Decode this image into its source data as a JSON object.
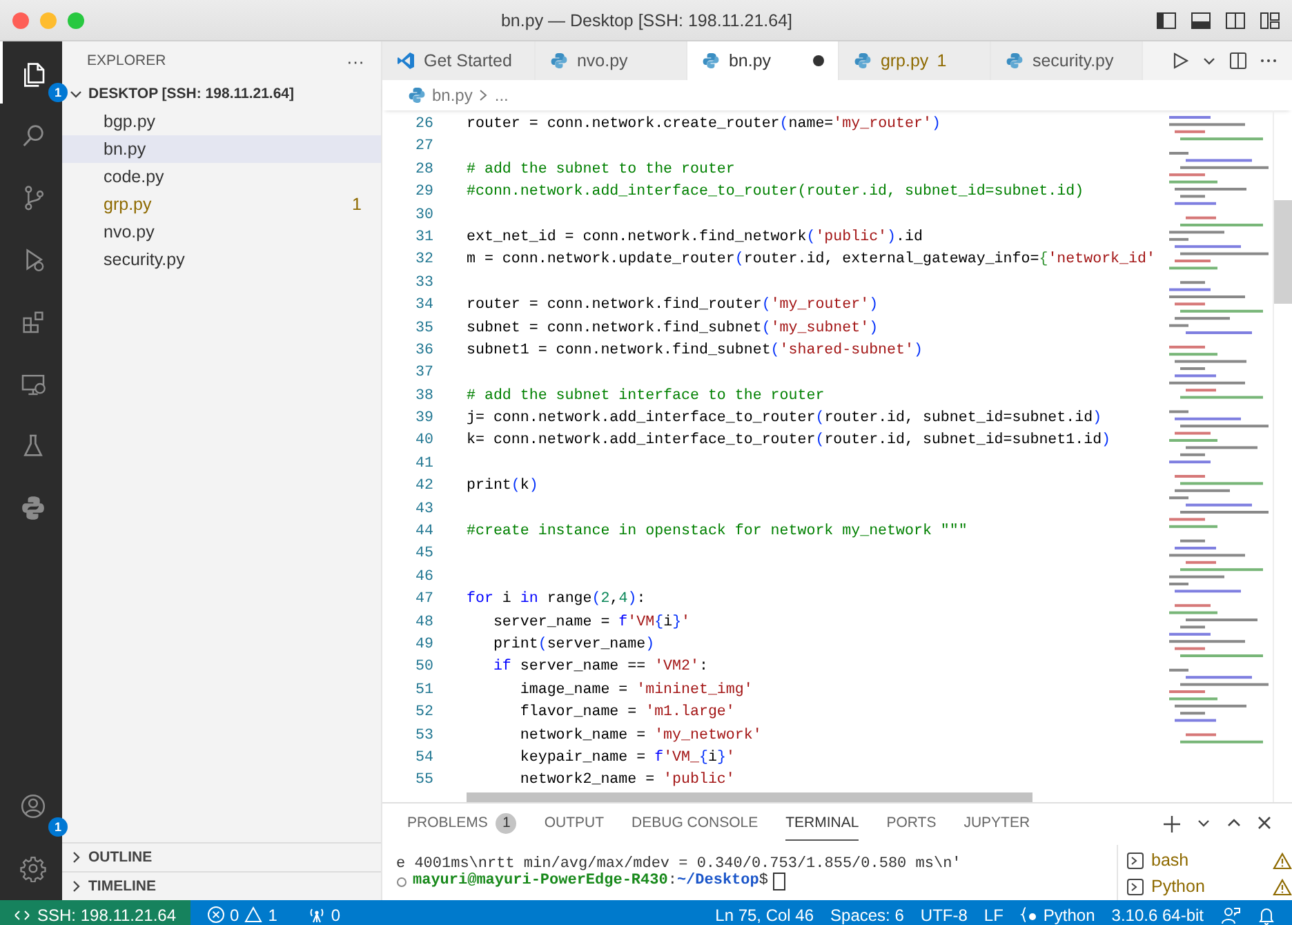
{
  "window": {
    "title": "bn.py — Desktop [SSH: 198.11.21.64]"
  },
  "activity_bar": {
    "items": [
      {
        "kind": "explorer",
        "selected": true,
        "badge": "1"
      },
      {
        "kind": "search",
        "selected": false
      },
      {
        "kind": "source-control",
        "selected": false
      },
      {
        "kind": "run",
        "selected": false
      },
      {
        "kind": "extensions",
        "selected": false
      },
      {
        "kind": "remote",
        "selected": false
      },
      {
        "kind": "testing",
        "selected": false
      },
      {
        "kind": "python",
        "selected": false
      }
    ],
    "bottom": [
      {
        "kind": "account",
        "badge": "1"
      },
      {
        "kind": "settings"
      }
    ]
  },
  "sidebar": {
    "title": "EXPLORER",
    "more": "···",
    "folder": {
      "label": "DESKTOP [SSH: 198.11.21.64]",
      "expanded": true
    },
    "files": [
      {
        "name": "bgp.py",
        "selected": false,
        "warning": false
      },
      {
        "name": "bn.py",
        "selected": true,
        "warning": false
      },
      {
        "name": "code.py",
        "selected": false,
        "warning": false
      },
      {
        "name": "grp.py",
        "selected": false,
        "warning": true,
        "problems": "1"
      },
      {
        "name": "nvo.py",
        "selected": false,
        "warning": false
      },
      {
        "name": "security.py",
        "selected": false,
        "warning": false
      }
    ],
    "sections": [
      {
        "label": "OUTLINE",
        "expanded": false
      },
      {
        "label": "TIMELINE",
        "expanded": false
      }
    ]
  },
  "tabs": [
    {
      "kind": "welcome",
      "label": "Get Started",
      "selected": false,
      "modified": false,
      "warning": false
    },
    {
      "kind": "python",
      "label": "nvo.py",
      "selected": false,
      "modified": false,
      "warning": false
    },
    {
      "kind": "python",
      "label": "bn.py",
      "selected": true,
      "modified": true,
      "warning": false
    },
    {
      "kind": "python",
      "label": "grp.py",
      "selected": false,
      "modified": false,
      "warning": true,
      "problems": "1"
    },
    {
      "kind": "python",
      "label": "security.py",
      "selected": false,
      "modified": false,
      "warning": false
    }
  ],
  "breadcrumb": [
    "bn.py",
    "..."
  ],
  "code": {
    "lines": [
      {
        "number": "26",
        "tokens": [
          {
            "kind": "plain",
            "text": "router = conn.network.create_router"
          },
          {
            "kind": "paren",
            "text": "("
          },
          {
            "kind": "plain",
            "text": "name="
          },
          {
            "kind": "string",
            "text": "'my_router'"
          },
          {
            "kind": "paren",
            "text": ")"
          }
        ]
      },
      {
        "number": "27"
      },
      {
        "number": "28",
        "tokens": [
          {
            "kind": "comment",
            "text": "# add the subnet to the router"
          }
        ]
      },
      {
        "number": "29",
        "tokens": [
          {
            "kind": "comment",
            "text": "#conn.network.add_interface_to_router(router.id, subnet_id=subnet.id)"
          }
        ]
      },
      {
        "number": "30"
      },
      {
        "number": "31",
        "tokens": [
          {
            "kind": "plain",
            "text": "ext_net_id = conn.network.find_network"
          },
          {
            "kind": "paren",
            "text": "("
          },
          {
            "kind": "string",
            "text": "'public'"
          },
          {
            "kind": "paren",
            "text": ")"
          },
          {
            "kind": "plain",
            "text": ".id"
          }
        ]
      },
      {
        "number": "32",
        "tokens": [
          {
            "kind": "plain",
            "text": "m = conn.network.update_router"
          },
          {
            "kind": "paren",
            "text": "("
          },
          {
            "kind": "plain",
            "text": "router.id, external_gateway_info="
          },
          {
            "kind": "brace",
            "text": "{"
          },
          {
            "kind": "string",
            "text": "'network_id'"
          }
        ]
      },
      {
        "number": "33"
      },
      {
        "number": "34",
        "tokens": [
          {
            "kind": "plain",
            "text": "router = conn.network.find_router"
          },
          {
            "kind": "paren",
            "text": "("
          },
          {
            "kind": "string",
            "text": "'my_router'"
          },
          {
            "kind": "paren",
            "text": ")"
          }
        ]
      },
      {
        "number": "35",
        "tokens": [
          {
            "kind": "plain",
            "text": "subnet = conn.network.find_subnet"
          },
          {
            "kind": "paren",
            "text": "("
          },
          {
            "kind": "string",
            "text": "'my_subnet'"
          },
          {
            "kind": "paren",
            "text": ")"
          }
        ]
      },
      {
        "number": "36",
        "tokens": [
          {
            "kind": "plain",
            "text": "subnet1 = conn.network.find_subnet"
          },
          {
            "kind": "paren",
            "text": "("
          },
          {
            "kind": "string",
            "text": "'shared-subnet'"
          },
          {
            "kind": "paren",
            "text": ")"
          }
        ]
      },
      {
        "number": "37"
      },
      {
        "number": "38",
        "tokens": [
          {
            "kind": "comment",
            "text": "# add the subnet interface to the router"
          }
        ]
      },
      {
        "number": "39",
        "tokens": [
          {
            "kind": "plain",
            "text": "j= conn.network.add_interface_to_router"
          },
          {
            "kind": "paren",
            "text": "("
          },
          {
            "kind": "plain",
            "text": "router.id, subnet_id=subnet.id"
          },
          {
            "kind": "paren",
            "text": ")"
          }
        ]
      },
      {
        "number": "40",
        "tokens": [
          {
            "kind": "plain",
            "text": "k= conn.network.add_interface_to_router"
          },
          {
            "kind": "paren",
            "text": "("
          },
          {
            "kind": "plain",
            "text": "router.id, subnet_id=subnet1.id"
          },
          {
            "kind": "paren",
            "text": ")"
          }
        ]
      },
      {
        "number": "41"
      },
      {
        "number": "42",
        "tokens": [
          {
            "kind": "plain",
            "text": "print"
          },
          {
            "kind": "paren",
            "text": "("
          },
          {
            "kind": "plain",
            "text": "k"
          },
          {
            "kind": "paren",
            "text": ")"
          }
        ]
      },
      {
        "number": "43"
      },
      {
        "number": "44",
        "tokens": [
          {
            "kind": "comment",
            "text": "#create instance in openstack for network my_network \"\"\""
          }
        ]
      },
      {
        "number": "45"
      },
      {
        "number": "46"
      },
      {
        "number": "47",
        "tokens": [
          {
            "kind": "keyword",
            "text": "for"
          },
          {
            "kind": "plain",
            "text": " i "
          },
          {
            "kind": "keyword",
            "text": "in"
          },
          {
            "kind": "plain",
            "text": " range"
          },
          {
            "kind": "paren",
            "text": "("
          },
          {
            "kind": "number",
            "text": "2"
          },
          {
            "kind": "plain",
            "text": ","
          },
          {
            "kind": "number",
            "text": "4"
          },
          {
            "kind": "paren",
            "text": ")"
          },
          {
            "kind": "plain",
            "text": ":"
          }
        ]
      },
      {
        "number": "48",
        "tokens": [
          {
            "kind": "plain",
            "text": "   server_name = "
          },
          {
            "kind": "keyword",
            "text": "f"
          },
          {
            "kind": "string",
            "text": "'VM"
          },
          {
            "kind": "paren",
            "text": "{"
          },
          {
            "kind": "plain",
            "text": "i"
          },
          {
            "kind": "paren",
            "text": "}"
          },
          {
            "kind": "string",
            "text": "'"
          }
        ]
      },
      {
        "number": "49",
        "tokens": [
          {
            "kind": "plain",
            "text": "   print"
          },
          {
            "kind": "paren",
            "text": "("
          },
          {
            "kind": "plain",
            "text": "server_name"
          },
          {
            "kind": "paren",
            "text": ")"
          }
        ]
      },
      {
        "number": "50",
        "tokens": [
          {
            "kind": "keyword",
            "text": "   if"
          },
          {
            "kind": "plain",
            "text": " server_name == "
          },
          {
            "kind": "string",
            "text": "'VM2'"
          },
          {
            "kind": "plain",
            "text": ":"
          }
        ]
      },
      {
        "number": "51",
        "tokens": [
          {
            "kind": "plain",
            "text": "      image_name = "
          },
          {
            "kind": "string",
            "text": "'mininet_img'"
          }
        ]
      },
      {
        "number": "52",
        "tokens": [
          {
            "kind": "plain",
            "text": "      flavor_name = "
          },
          {
            "kind": "string",
            "text": "'m1.large'"
          }
        ]
      },
      {
        "number": "53",
        "tokens": [
          {
            "kind": "plain",
            "text": "      network_name = "
          },
          {
            "kind": "string",
            "text": "'my_network'"
          }
        ]
      },
      {
        "number": "54",
        "tokens": [
          {
            "kind": "plain",
            "text": "      keypair_name = "
          },
          {
            "kind": "keyword",
            "text": "f"
          },
          {
            "kind": "string",
            "text": "'VM_"
          },
          {
            "kind": "paren",
            "text": "{"
          },
          {
            "kind": "plain",
            "text": "i"
          },
          {
            "kind": "paren",
            "text": "}"
          },
          {
            "kind": "string",
            "text": "'"
          }
        ]
      },
      {
        "number": "55",
        "tokens": [
          {
            "kind": "plain",
            "text": "      network2_name = "
          },
          {
            "kind": "string",
            "text": "'public'"
          }
        ]
      }
    ]
  },
  "panel": {
    "tabs": [
      {
        "label": "PROBLEMS",
        "selected": false,
        "badge": "1"
      },
      {
        "label": "OUTPUT",
        "selected": false
      },
      {
        "label": "DEBUG CONSOLE",
        "selected": false
      },
      {
        "label": "TERMINAL",
        "selected": true
      },
      {
        "label": "PORTS",
        "selected": false
      },
      {
        "label": "JUPYTER",
        "selected": false
      }
    ],
    "terminal": {
      "output": "e 4001ms\\nrtt min/avg/max/mdev = 0.340/0.753/1.855/0.580 ms\\n'",
      "prompt_user": "mayuri@mayuri-PowerEdge-R430",
      "prompt_sep": ":",
      "prompt_path": "~/Desktop",
      "prompt_end": "$"
    },
    "terminals": [
      {
        "name": "bash",
        "warning": true
      },
      {
        "name": "Python",
        "warning": true
      }
    ]
  },
  "status_bar": {
    "remote": "SSH: 198.11.21.64",
    "errors": "0",
    "warnings": "1",
    "ports": "0",
    "right": [
      {
        "kind": "text",
        "text": "Ln 75, Col 46"
      },
      {
        "kind": "text",
        "text": "Spaces: 6"
      },
      {
        "kind": "text",
        "text": "UTF-8"
      },
      {
        "kind": "text",
        "text": "LF"
      },
      {
        "kind": "language",
        "text": "Python"
      },
      {
        "kind": "text",
        "text": "3.10.6 64-bit"
      }
    ]
  }
}
